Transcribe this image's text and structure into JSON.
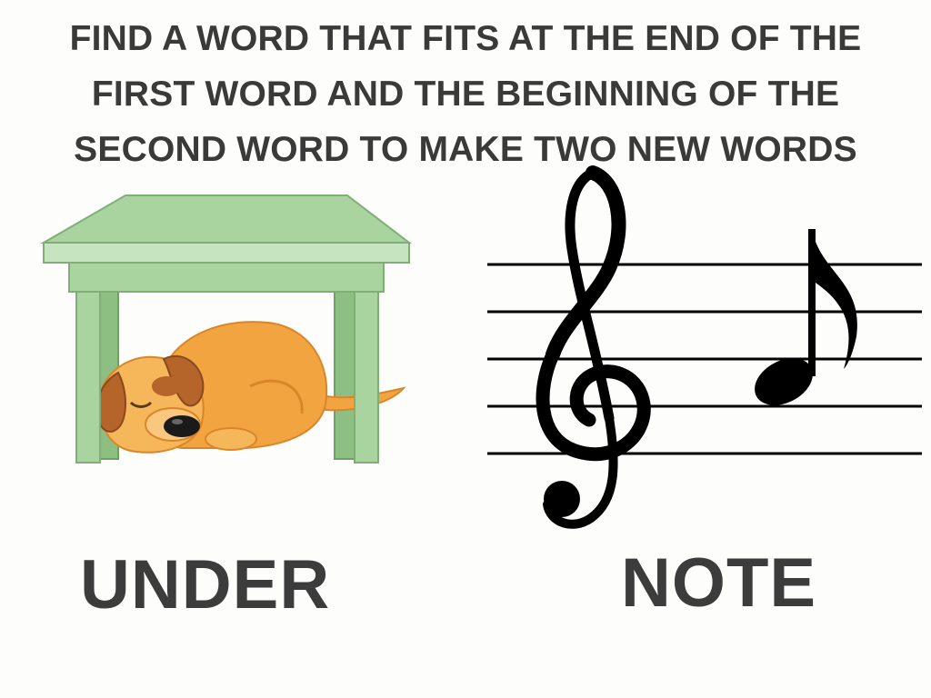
{
  "instructions": {
    "lines": [
      "FIND A WORD THAT FITS AT THE END OF THE",
      "FIRST WORD AND THE BEGINNING OF THE",
      "SECOND WORD TO MAKE TWO NEW WORDS"
    ]
  },
  "pictures": {
    "left": {
      "icon": "dog-under-table-icon"
    },
    "right": {
      "icon": "treble-clef-note-icon"
    }
  },
  "words": {
    "first": "UNDER",
    "second": "NOTE"
  },
  "colors": {
    "text": "#3a3a3a",
    "table_green": "#a9d4a0",
    "dog_orange": "#f2a441",
    "ink": "#000000"
  }
}
